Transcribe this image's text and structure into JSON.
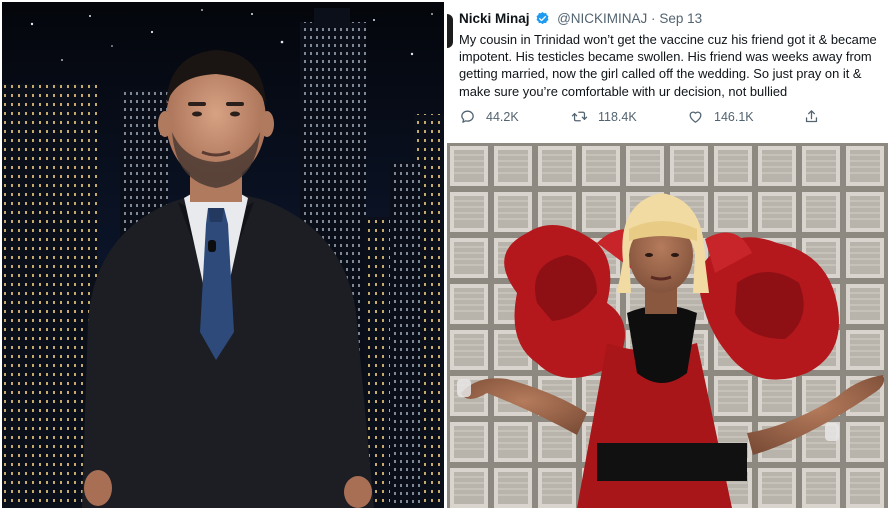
{
  "tweet": {
    "name": "Nicki Minaj",
    "handle": "@NICKIMINAJ",
    "separator": "·",
    "date": "Sep 13",
    "text": "My cousin in Trinidad won’t get the vaccine cuz his friend got it & became impotent. His testicles became swollen. His friend was weeks away from getting married, now the girl called off the wedding. So just pray on it & make sure you’re comfortable with ur decision, not bullied",
    "stats": {
      "replies": "44.2K",
      "retweets": "118.4K",
      "likes": "146.1K"
    },
    "icons": {
      "verified": "verified-badge-icon",
      "reply": "reply-bubble-icon",
      "retweet": "retweet-arrows-icon",
      "like": "heart-icon",
      "share": "share-upload-icon"
    },
    "colors": {
      "text": "#0f1419",
      "secondary": "#536471",
      "verified": "#1d9bf0"
    }
  }
}
